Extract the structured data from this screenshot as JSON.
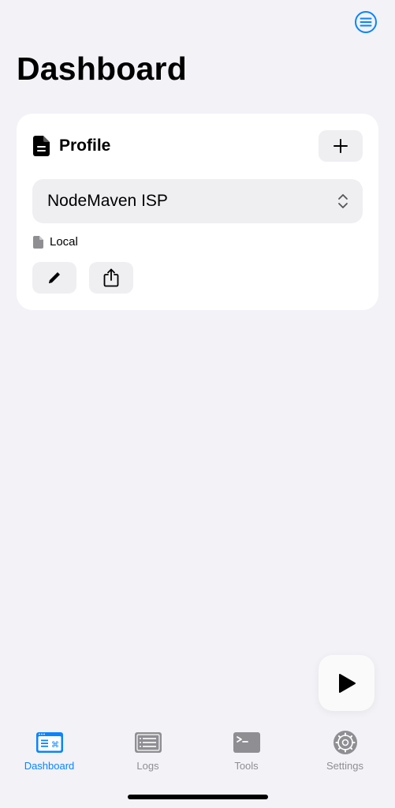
{
  "header": {
    "title": "Dashboard",
    "menu_icon": "list-circle-icon"
  },
  "profile_card": {
    "title": "Profile",
    "header_icon": "document-icon",
    "add_icon": "plus-icon",
    "selected_profile": "NodeMaven ISP",
    "source_icon": "document-icon",
    "source_label": "Local",
    "edit_icon": "pencil-icon",
    "share_icon": "share-icon"
  },
  "play_button": {
    "icon": "play-icon"
  },
  "tabbar": {
    "tabs": [
      {
        "label": "Dashboard",
        "icon": "dashboard-icon",
        "active": true
      },
      {
        "label": "Logs",
        "icon": "logs-icon",
        "active": false
      },
      {
        "label": "Tools",
        "icon": "terminal-icon",
        "active": false
      },
      {
        "label": "Settings",
        "icon": "gear-icon",
        "active": false
      }
    ]
  },
  "colors": {
    "background": "#f2f2f7",
    "card": "#ffffff",
    "accent": "#0a84ff",
    "inactive": "#8e8e93",
    "button_fill": "#efeff2"
  }
}
